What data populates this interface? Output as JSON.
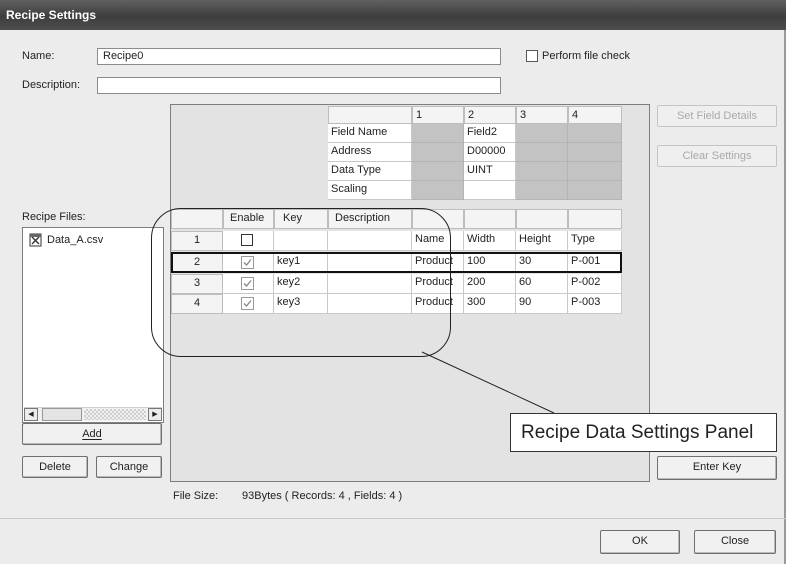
{
  "title": "Recipe Settings",
  "form": {
    "name_label": "Name:",
    "name_value": "Recipe0",
    "description_label": "Description:",
    "description_value": "",
    "perform_file_check": "Perform file check",
    "perform_file_check_checked": false
  },
  "recipe_files": {
    "label": "Recipe Files:",
    "items": [
      "Data_A.csv"
    ],
    "add_label": "Add",
    "delete_label": "Delete",
    "change_label": "Change"
  },
  "field_header": {
    "column_numbers": [
      "1",
      "2",
      "3",
      "4"
    ],
    "row_labels": [
      "Field Name",
      "Address",
      "Data Type",
      "Scaling"
    ],
    "values": {
      "field_name": [
        "",
        "Field2",
        "",
        ""
      ],
      "address": [
        "",
        "D00000",
        "",
        ""
      ],
      "data_type": [
        "",
        "UINT",
        "",
        ""
      ],
      "scaling": [
        "",
        "",
        "",
        ""
      ]
    }
  },
  "table": {
    "headers": [
      "Enable",
      "Key",
      "Description"
    ],
    "rows": [
      {
        "no": "1",
        "enabled": false,
        "key": "",
        "description": "",
        "c1": "Name",
        "c2": "Width",
        "c3": "Height",
        "c4": "Type"
      },
      {
        "no": "2",
        "enabled": true,
        "key": "key1",
        "description": "",
        "c1": "Product",
        "c2": "100",
        "c3": "30",
        "c4": "P-001"
      },
      {
        "no": "3",
        "enabled": true,
        "key": "key2",
        "description": "",
        "c1": "Product",
        "c2": "200",
        "c3": "60",
        "c4": "P-002"
      },
      {
        "no": "4",
        "enabled": true,
        "key": "key3",
        "description": "",
        "c1": "Product",
        "c2": "300",
        "c3": "90",
        "c4": "P-003"
      }
    ],
    "selected_row": "2"
  },
  "side_buttons": {
    "set_field_details": "Set Field Details",
    "clear_settings": "Clear Settings",
    "enter_key": "Enter Key"
  },
  "file_size": {
    "label": "File Size:",
    "value": "93Bytes  ( Records: 4 , Fields: 4 )"
  },
  "callout_text": "Recipe Data Settings Panel",
  "footer": {
    "ok_label": "OK",
    "close_label": "Close"
  },
  "icons": {
    "file": "csv-file-icon",
    "scroll_left": "arrow-left-icon",
    "scroll_right": "arrow-right-icon"
  }
}
